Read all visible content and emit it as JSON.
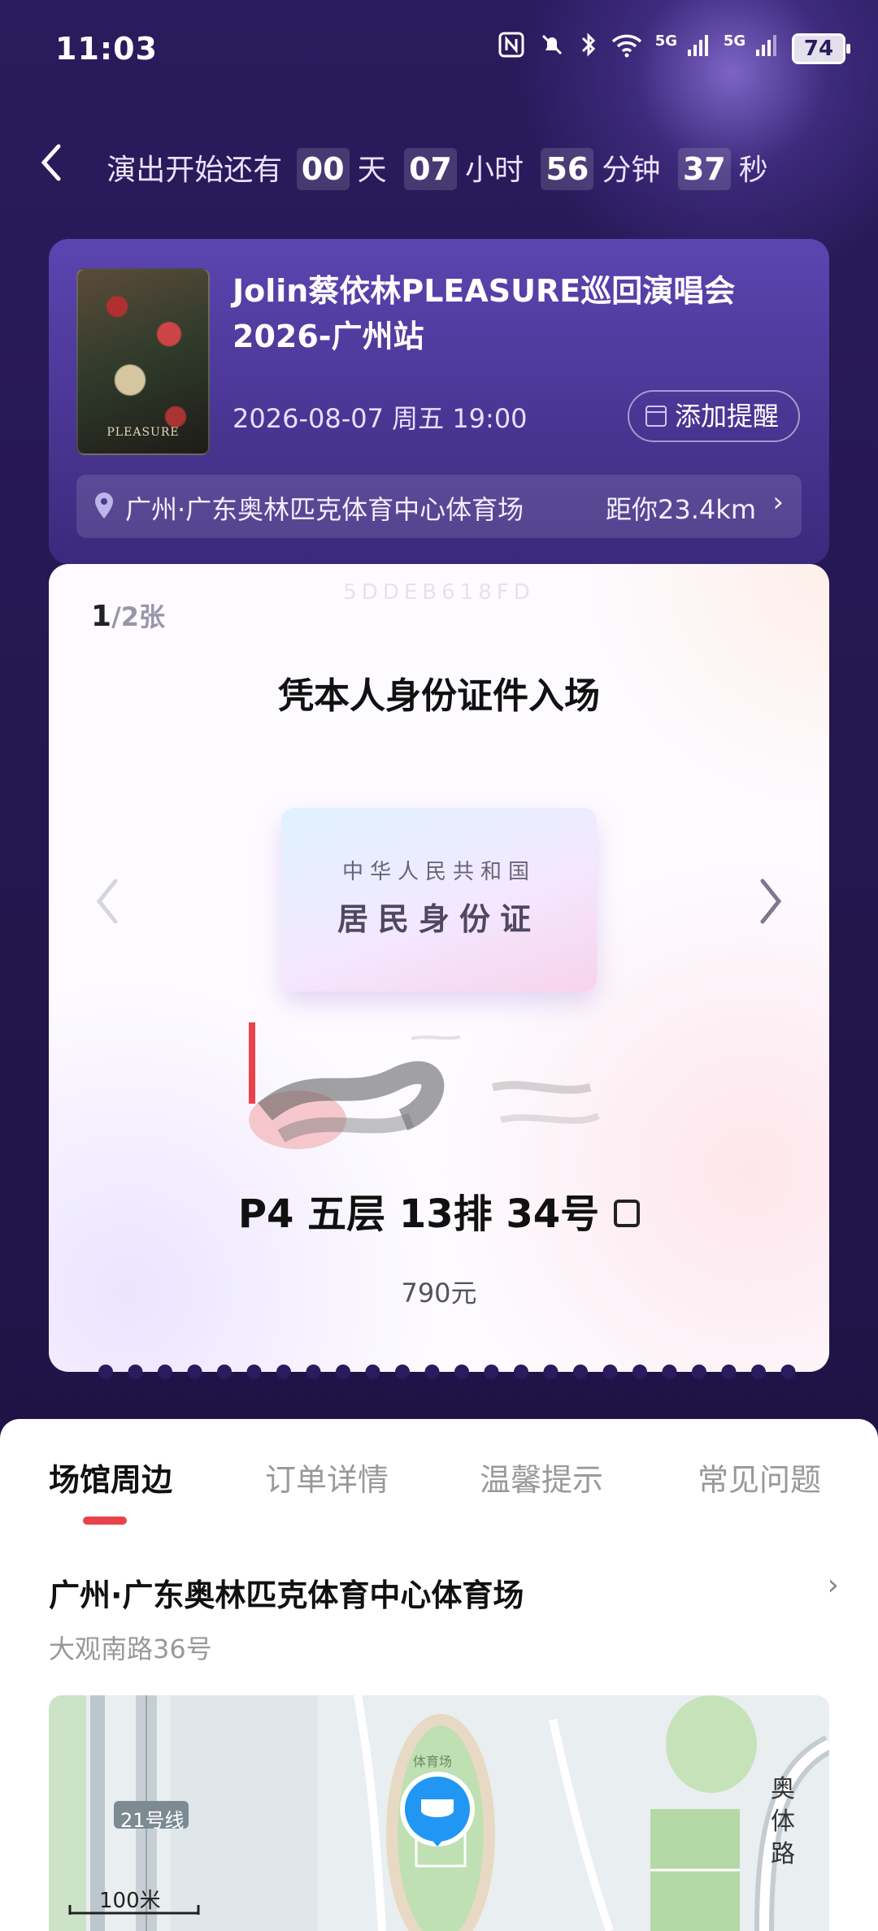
{
  "status_bar": {
    "time": "11:03",
    "battery": "74",
    "signal_label_1": "5G",
    "signal_label_2": "5G"
  },
  "header": {
    "back_icon": "chevron-left-icon",
    "countdown_prefix": "演出开始还有",
    "days": "00",
    "days_unit": "天",
    "hours": "07",
    "hours_unit": "小时",
    "minutes": "56",
    "minutes_unit": "分钟",
    "seconds": "37",
    "seconds_unit": "秒"
  },
  "event": {
    "title": "Jolin蔡依林PLEASURE巡回演唱会2026-广州站",
    "poster_text": "PLEASURE",
    "datetime": "2026-08-07 周五 19:00",
    "remind_label": "添加提醒",
    "venue": "广州·广东奥林匹克体育中心体育场",
    "distance": "距你23.4km"
  },
  "ticket": {
    "code": "5DDEB618FD",
    "index": "1",
    "total": "/2张",
    "title": "凭本人身份证件入场",
    "id_card_line1": "中华人民共和国",
    "id_card_line2": "居民身份证",
    "seat": "P4 五层 13排 34号",
    "price": "790元"
  },
  "tabs": [
    {
      "label": "场馆周边",
      "active": true
    },
    {
      "label": "订单详情",
      "active": false
    },
    {
      "label": "温馨提示",
      "active": false
    },
    {
      "label": "常见问题",
      "active": false
    }
  ],
  "venue_section": {
    "name": "广州·广东奥林匹克体育中心体育场",
    "address": "大观南路36号"
  },
  "map": {
    "metro_label": "21号线",
    "scale_label": "100米",
    "road_label": "奥体路",
    "stadium_label": "体育场"
  },
  "colors": {
    "accent_red": "#e8434b",
    "header_purple": "#2a1b5e",
    "card_purple": "#5b45b0",
    "map_pin_blue": "#2196f3"
  }
}
